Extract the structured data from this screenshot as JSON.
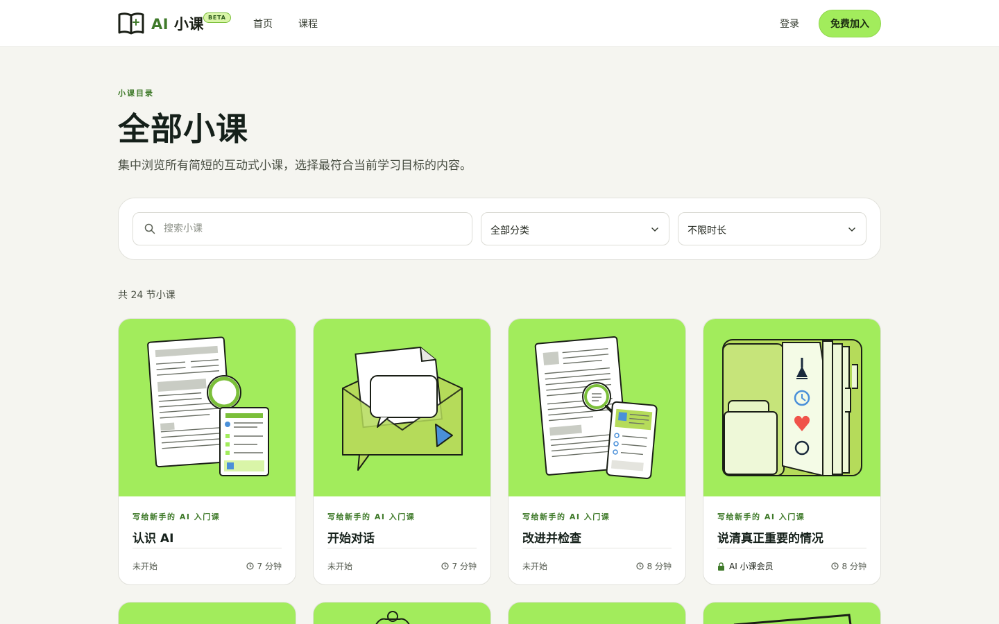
{
  "brand": {
    "name_ai": "AI",
    "name_rest": " 小课",
    "badge": "BETA"
  },
  "nav": {
    "home": "首页",
    "courses": "课程",
    "login": "登录",
    "join": "免费加入"
  },
  "hero": {
    "eyebrow": "小课目录",
    "title": "全部小课",
    "subtitle": "集中浏览所有简短的互动式小课，选择最符合当前学习目标的内容。"
  },
  "filters": {
    "search_placeholder": "搜索小课",
    "search_value": "",
    "category": "全部分类",
    "duration": "不限时长"
  },
  "count_label": "共 24 节小课",
  "accent_color": "#a2ec5c",
  "brand_green": "#3f7a2a",
  "lessons": [
    {
      "series": "写给新手的 AI 入门课",
      "title": "认识 AI",
      "status": "未开始",
      "locked": false,
      "duration": "7 分钟",
      "illustration": "documents-magnifier"
    },
    {
      "series": "写给新手的 AI 入门课",
      "title": "开始对话",
      "status": "未开始",
      "locked": false,
      "duration": "7 分钟",
      "illustration": "envelope-chat"
    },
    {
      "series": "写给新手的 AI 入门课",
      "title": "改进并检查",
      "status": "未开始",
      "locked": false,
      "duration": "8 分钟",
      "illustration": "document-checklist"
    },
    {
      "series": "写给新手的 AI 入门课",
      "title": "说清真正重要的情况",
      "status": "AI 小课会员",
      "locked": true,
      "duration": "8 分钟",
      "illustration": "folder-tabs"
    }
  ]
}
